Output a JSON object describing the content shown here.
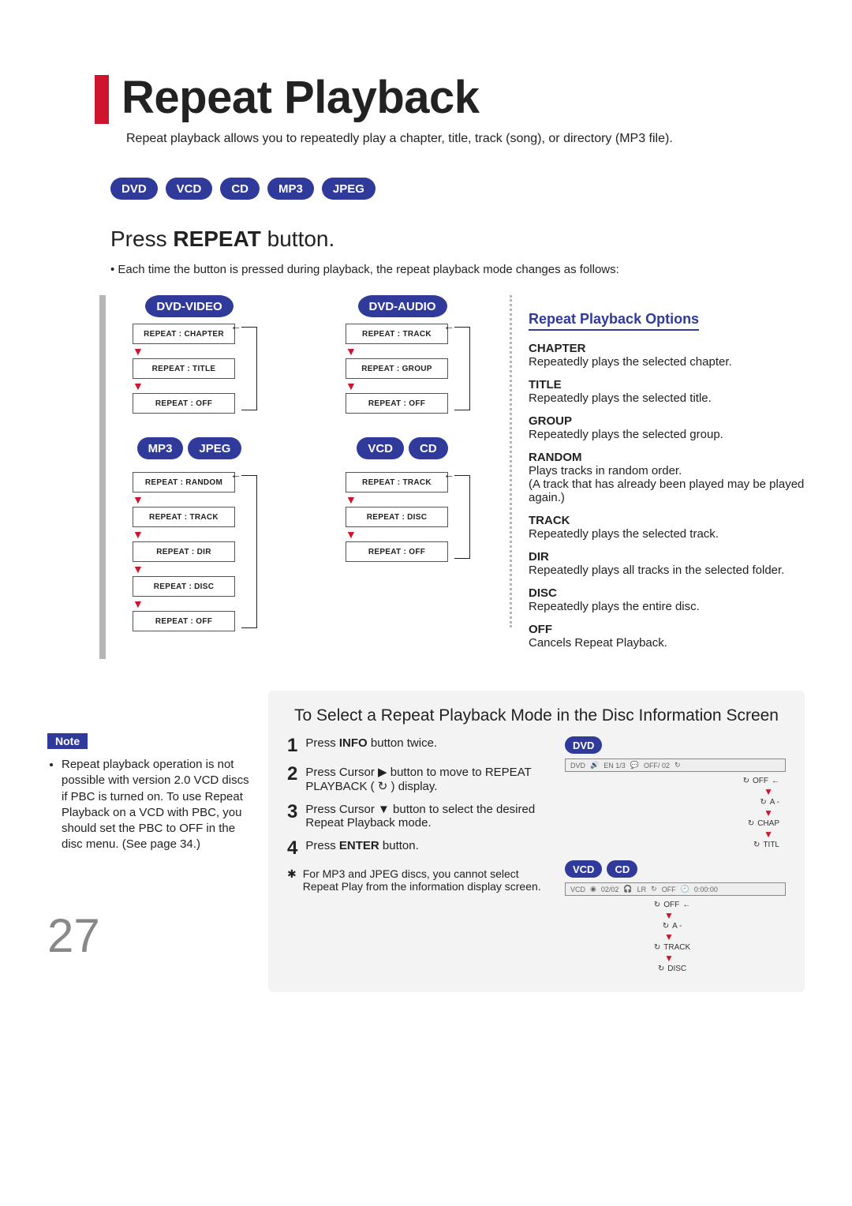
{
  "title": "Repeat Playback",
  "subtitle": "Repeat playback allows you to repeatedly play a chapter, title, track (song), or directory (MP3 file).",
  "format_pills": [
    "DVD",
    "VCD",
    "CD",
    "MP3",
    "JPEG"
  ],
  "press_heading_pre": "Press ",
  "press_heading_strong": "REPEAT",
  "press_heading_post": " button.",
  "press_note": "• Each time the button is pressed during playback, the repeat playback mode changes as follows:",
  "flows": {
    "dvd_video": {
      "pill": "DVD-VIDEO",
      "items": [
        "REPEAT : CHAPTER",
        "REPEAT : TITLE",
        "REPEAT : OFF"
      ]
    },
    "dvd_audio": {
      "pill": "DVD-AUDIO",
      "items": [
        "REPEAT : TRACK",
        "REPEAT : GROUP",
        "REPEAT : OFF"
      ]
    },
    "mp3_jpeg": {
      "pill_a": "MP3",
      "pill_b": "JPEG",
      "items": [
        "REPEAT : RANDOM",
        "REPEAT : TRACK",
        "REPEAT : DIR",
        "REPEAT : DISC",
        "REPEAT : OFF"
      ]
    },
    "vcd_cd": {
      "pill_a": "VCD",
      "pill_b": "CD",
      "items": [
        "REPEAT : TRACK",
        "REPEAT : DISC",
        "REPEAT : OFF"
      ]
    }
  },
  "options_heading": "Repeat Playback Options",
  "options": [
    {
      "k": "CHAPTER",
      "v": "Repeatedly plays the selected chapter."
    },
    {
      "k": "TITLE",
      "v": "Repeatedly plays the selected title."
    },
    {
      "k": "GROUP",
      "v": "Repeatedly plays the selected group."
    },
    {
      "k": "RANDOM",
      "v": "Plays tracks in random order.\n(A track that has already been played may be played again.)"
    },
    {
      "k": "TRACK",
      "v": "Repeatedly plays the selected track."
    },
    {
      "k": "DIR",
      "v": "Repeatedly plays all tracks in the selected folder."
    },
    {
      "k": "DISC",
      "v": "Repeatedly plays the entire disc."
    },
    {
      "k": "OFF",
      "v": "Cancels Repeat Playback."
    }
  ],
  "note_label": "Note",
  "note_text": "Repeat playback operation is not possible with version 2.0 VCD discs if PBC is turned on. To use Repeat Playback on a VCD with PBC, you should set the PBC to OFF in the disc menu. (See page 34.)",
  "page_number": "27",
  "info_screen": {
    "title": "To Select a Repeat Playback Mode in the Disc Information Screen",
    "steps": [
      {
        "n": "1",
        "pre": "Press ",
        "strong": "INFO",
        "post": " button twice."
      },
      {
        "n": "2",
        "pre": "Press Cursor ▶ button to move to REPEAT PLAYBACK ( ",
        "strong": "",
        "post": " ) display."
      },
      {
        "n": "3",
        "pre": "Press Cursor ▼ button to select the desired Repeat Playback mode.",
        "strong": "",
        "post": ""
      },
      {
        "n": "4",
        "pre": "Press ",
        "strong": "ENTER",
        "post": " button."
      }
    ],
    "footnote_star": "✱",
    "footnote": "For MP3 and JPEG discs, you cannot select Repeat Play from the information display screen.",
    "dvd_pill": "DVD",
    "dvd_strip": [
      "DVD",
      "EN 1/3",
      "OFF/ 02"
    ],
    "dvd_repeat_tree": [
      "OFF",
      "A -",
      "CHAP",
      "TITL"
    ],
    "vcd_pill_a": "VCD",
    "vcd_pill_b": "CD",
    "vcd_strip": [
      "VCD",
      "02/02",
      "LR",
      "OFF",
      "0:00:00"
    ],
    "vcd_repeat_tree": [
      "OFF",
      "A -",
      "TRACK",
      "DISC"
    ]
  }
}
